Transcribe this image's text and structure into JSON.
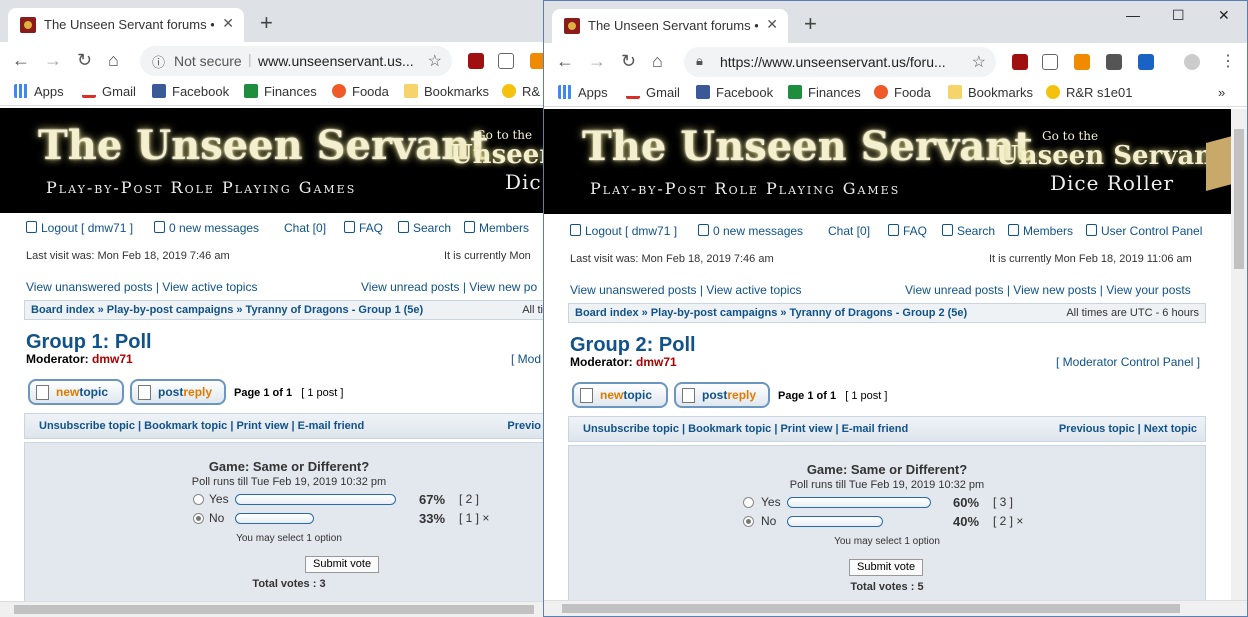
{
  "w1": {
    "tab_title": "The Unseen Servant forums • Vie",
    "security_label": "Not secure",
    "url": "www.unseenservant.us...",
    "banner_dice1": "Unseen",
    "banner_dice2": "Dic",
    "header_links": {
      "logout": "Logout [ dmw71 ]",
      "messages": "0 new messages",
      "chat": "Chat [0]",
      "faq": "FAQ",
      "search": "Search",
      "members": "Members"
    },
    "last_visit": "Last visit was: Mon Feb 18, 2019 7:46 am",
    "current": "It is currently Mon",
    "quick_left": "View unanswered posts | View active topics",
    "quick_right": "View unread posts | View new po",
    "breadcrumb": "Board index » Play-by-post campaigns » Tyranny of Dragons - Group 1 (5e)",
    "timezone": "All ti",
    "title": "Group 1: Poll",
    "mod_label": "Moderator:",
    "mod_name": "dmw71",
    "mcp": "[ Mod",
    "page": "Page 1 of 1",
    "posts": "[ 1 post ]",
    "actions_left": "Unsubscribe topic | Bookmark topic | Print view | E-mail friend",
    "actions_right": "Previo",
    "poll": {
      "question": "Game: Same or Different?",
      "runs": "Poll runs till Tue Feb 19, 2019 10:32 pm",
      "options": [
        {
          "label": "Yes",
          "pct": "67%",
          "count": "[ 2 ]",
          "value": 0.67
        },
        {
          "label": "No",
          "pct": "33%",
          "count": "[ 1 ] ×",
          "value": 0.33
        }
      ],
      "select": "You may select 1 option",
      "submit": "Submit vote",
      "total": "Total votes : 3"
    }
  },
  "w2": {
    "tab_title": "The Unseen Servant forums • Vie",
    "url": "https://www.unseenservant.us/foru...",
    "banner_dice1": "Unseen Servant",
    "banner_dice2": "Dice Roller",
    "header_links": {
      "logout": "Logout [ dmw71 ]",
      "messages": "0 new messages",
      "chat": "Chat [0]",
      "faq": "FAQ",
      "search": "Search",
      "members": "Members",
      "ucp": "User Control Panel"
    },
    "last_visit": "Last visit was: Mon Feb 18, 2019 7:46 am",
    "current": "It is currently Mon Feb 18, 2019 11:06 am",
    "quick_left": "View unanswered posts | View active topics",
    "quick_right": "View unread posts | View new posts | View your posts",
    "breadcrumb": "Board index » Play-by-post campaigns » Tyranny of Dragons - Group 2 (5e)",
    "timezone": "All times are UTC - 6 hours",
    "title": "Group 2: Poll",
    "mod_label": "Moderator:",
    "mod_name": "dmw71",
    "mcp": "[ Moderator Control Panel ]",
    "page": "Page 1 of 1",
    "posts": "[ 1 post ]",
    "actions_left": "Unsubscribe topic | Bookmark topic | Print view | E-mail friend",
    "actions_right": "Previous topic | Next topic",
    "poll": {
      "question": "Game: Same or Different?",
      "runs": "Poll runs till Tue Feb 19, 2019 10:32 pm",
      "options": [
        {
          "label": "Yes",
          "pct": "60%",
          "count": "[ 3 ]",
          "value": 0.6
        },
        {
          "label": "No",
          "pct": "40%",
          "count": "[ 2 ] ×",
          "value": 0.4
        }
      ],
      "select": "You may select 1 option",
      "submit": "Submit vote",
      "total": "Total votes : 5"
    }
  },
  "bookmarks": [
    "Apps",
    "Gmail",
    "Facebook",
    "Finances",
    "Fooda",
    "Bookmarks",
    "R&R s1e01"
  ],
  "bookmarks_w1_cut": "R&",
  "banner": {
    "logo": "The Unseen Servant",
    "sub": "Play-by-Post Role Playing Games",
    "go": "Go to the"
  },
  "buttons": {
    "new": "new",
    "topic": "topic",
    "post": "post",
    "reply": "reply"
  },
  "colors": {
    "link": "#105289",
    "mod_name": "#aa0000",
    "accent_orange": "#e07a00"
  }
}
